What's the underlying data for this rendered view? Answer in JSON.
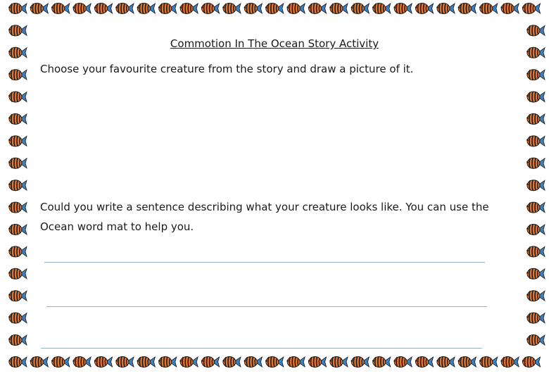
{
  "worksheet": {
    "title": "Commotion In The Ocean Story Activity",
    "prompt_draw": "Choose your favourite creature from the story and draw a picture of it.",
    "prompt_write_line1": "Could you write a sentence describing what your creature looks like. You can use the",
    "prompt_write_line2": "Ocean word mat to help you.",
    "writing_lines": 3
  },
  "border": {
    "icon": "striped-fish-icon",
    "fish_colors": {
      "orange": "#e8742a",
      "black": "#1c1c1c",
      "fin_blue": "#3b7fc0"
    },
    "writing_line_color": "#9aaed0"
  }
}
